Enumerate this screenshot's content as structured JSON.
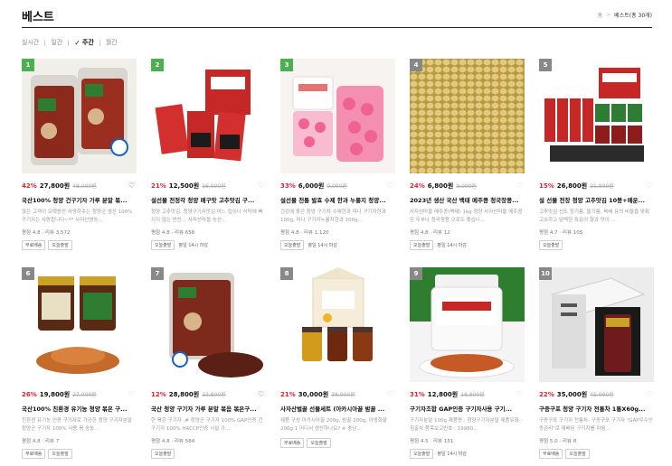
{
  "header": {
    "title": "베스트"
  },
  "breadcrumb": {
    "home": "홈",
    "sep": ">",
    "current": "베스트(총 30개)"
  },
  "tabs": [
    {
      "label": "실시간",
      "active": false
    },
    {
      "label": "일간",
      "active": false
    },
    {
      "label": "주간",
      "active": true
    },
    {
      "label": "월간",
      "active": false
    }
  ],
  "products": [
    {
      "rank": "1",
      "discount": "42%",
      "price": "27,800원",
      "original": "48,000원",
      "liked": true,
      "name": "국산100% 청양 건구기자 가루 분말 볶...",
      "desc": "많은 고객이 오랫동안 사랑하주는 청양군 생산 100% 구기자는 사랑합니다~** 사자산영농...",
      "rating": "평점 4.8 · 리뷰 3,572",
      "badges": [
        "무료배송",
        "오늘출발"
      ],
      "ship": ""
    },
    {
      "rank": "2",
      "discount": "21%",
      "price": "12,500원",
      "original": "16,000원",
      "liked": false,
      "name": "설선물 전정각 청양 메구맛 고추맛김 구...",
      "desc": "청양 고추맛김, 청양구기자맛김 어느 집이나 식탁에 빠지지 않는 반찬... 사자산마을 농산...",
      "rating": "평점 4.8 · 리뷰 658",
      "badges": [
        "오늘출발"
      ],
      "ship": "평일 14시 마감"
    },
    {
      "rank": "3",
      "discount": "33%",
      "price": "6,000원",
      "original": "9,000원",
      "liked": false,
      "name": "설선물 전통 발효 수제 한과 누룽지 청양...",
      "desc": "건강에 좋은 청양 구기자 수제한과 미니 구기자한과 100g, 미니 구기자누룽지한과 100g...",
      "rating": "평점 4.8 · 리뷰 1,120",
      "badges": [
        "오늘출발"
      ],
      "ship": "평일 14시 마감"
    },
    {
      "rank": "4",
      "discount": "24%",
      "price": "6,800원",
      "original": "9,000원",
      "liked": false,
      "name": "2023년 생산 국산 백태 메주콩 청국장콩...",
      "desc": "사자산마을 메주콩(백태) 1kg 청양 사자산마을 메주콩은 두부나 청국장용 으로도 좋습니...",
      "rating": "평점 4.8 · 리뷰 12",
      "badges": [
        "오늘출발"
      ],
      "ship": "평일 14시 마감"
    },
    {
      "rank": "5",
      "discount": "15%",
      "price": "26,800원",
      "original": "31,800원",
      "liked": false,
      "name": "설 선물 전장 청양 고추맛김 10봉+메운...",
      "desc": "고추맛김 선도 청기름, 들기름, 육배 유의 비율을 맞춰 고소하고 담백한 특유의 향과 맛이 ...",
      "rating": "평점 4.7 · 리뷰 105",
      "badges": [
        "오늘출발"
      ],
      "ship": ""
    },
    {
      "rank": "6",
      "discount": "26%",
      "price": "19,800원",
      "original": "27,000원",
      "liked": false,
      "name": "국산100% 친환경 유기농 청양 볶은 구...",
      "desc": "친환경 유기농 인증 구기자로 가공한 청양 구기자분말 청양군 구기자 100% 사용 볶 송농...",
      "rating": "평점 4.8 · 리뷰 7",
      "badges": [
        "무료배송",
        "오늘출발"
      ],
      "ship": ""
    },
    {
      "rank": "7",
      "discount": "12%",
      "price": "28,800원",
      "original": "32,800원",
      "liked": true,
      "name": "국산 청양 구기자 가루 분말 볶음 볶은구...",
      "desc": "한 볶은 구기자 ,# 청양군 구기자 100% GAP인증 건구기자 100% HACCP인증 시설 가...",
      "rating": "평점 4.8 · 리뷰 584",
      "badges": [
        "오늘출발"
      ],
      "ship": ""
    },
    {
      "rank": "8",
      "discount": "21%",
      "price": "30,000원",
      "original": "38,000원",
      "liked": false,
      "name": "사자산벌꿀 선물세트 (아카시아꿀 밤꿀 ...",
      "desc": "제품 구성 아카시아꿀 200g, 밤꿀 200g, 야생화꿀 200g 1 어디서 생산하나요? ※ 충남...",
      "rating": "",
      "badges": [
        "무료배송",
        "오늘출발"
      ],
      "ship": ""
    },
    {
      "rank": "9",
      "discount": "31%",
      "price": "12,800원",
      "original": "18,800원",
      "liked": false,
      "name": "구기자조합 GAP인증 구기자사용 구기...",
      "desc": "구기자분말 100g 제품명 : 청양구기자분말 제품유형 : 침출차 품목보고번호 : 19980...",
      "rating": "평점 4.5 · 리뷰 151",
      "badges": [
        "오늘출발"
      ],
      "ship": "평일 14시 마감"
    },
    {
      "rank": "10",
      "discount": "22%",
      "price": "35,000원",
      "original": "45,000원",
      "liked": false,
      "name": "구증구포 청양 구기자 전통차 1통X60g...",
      "desc": "구증구포 구기자 전통차- 구증구포 구기자 \"GAP우수인증관리\"로 재배된 구기자를 마음...",
      "rating": "평점 5.0 · 리뷰 8",
      "badges": [
        "무료배송",
        "오늘출발"
      ],
      "ship": ""
    }
  ],
  "colors": {
    "discount": "#e2232f",
    "rank_bg": "#4caf50",
    "rank_bg_alt": "#888888"
  }
}
